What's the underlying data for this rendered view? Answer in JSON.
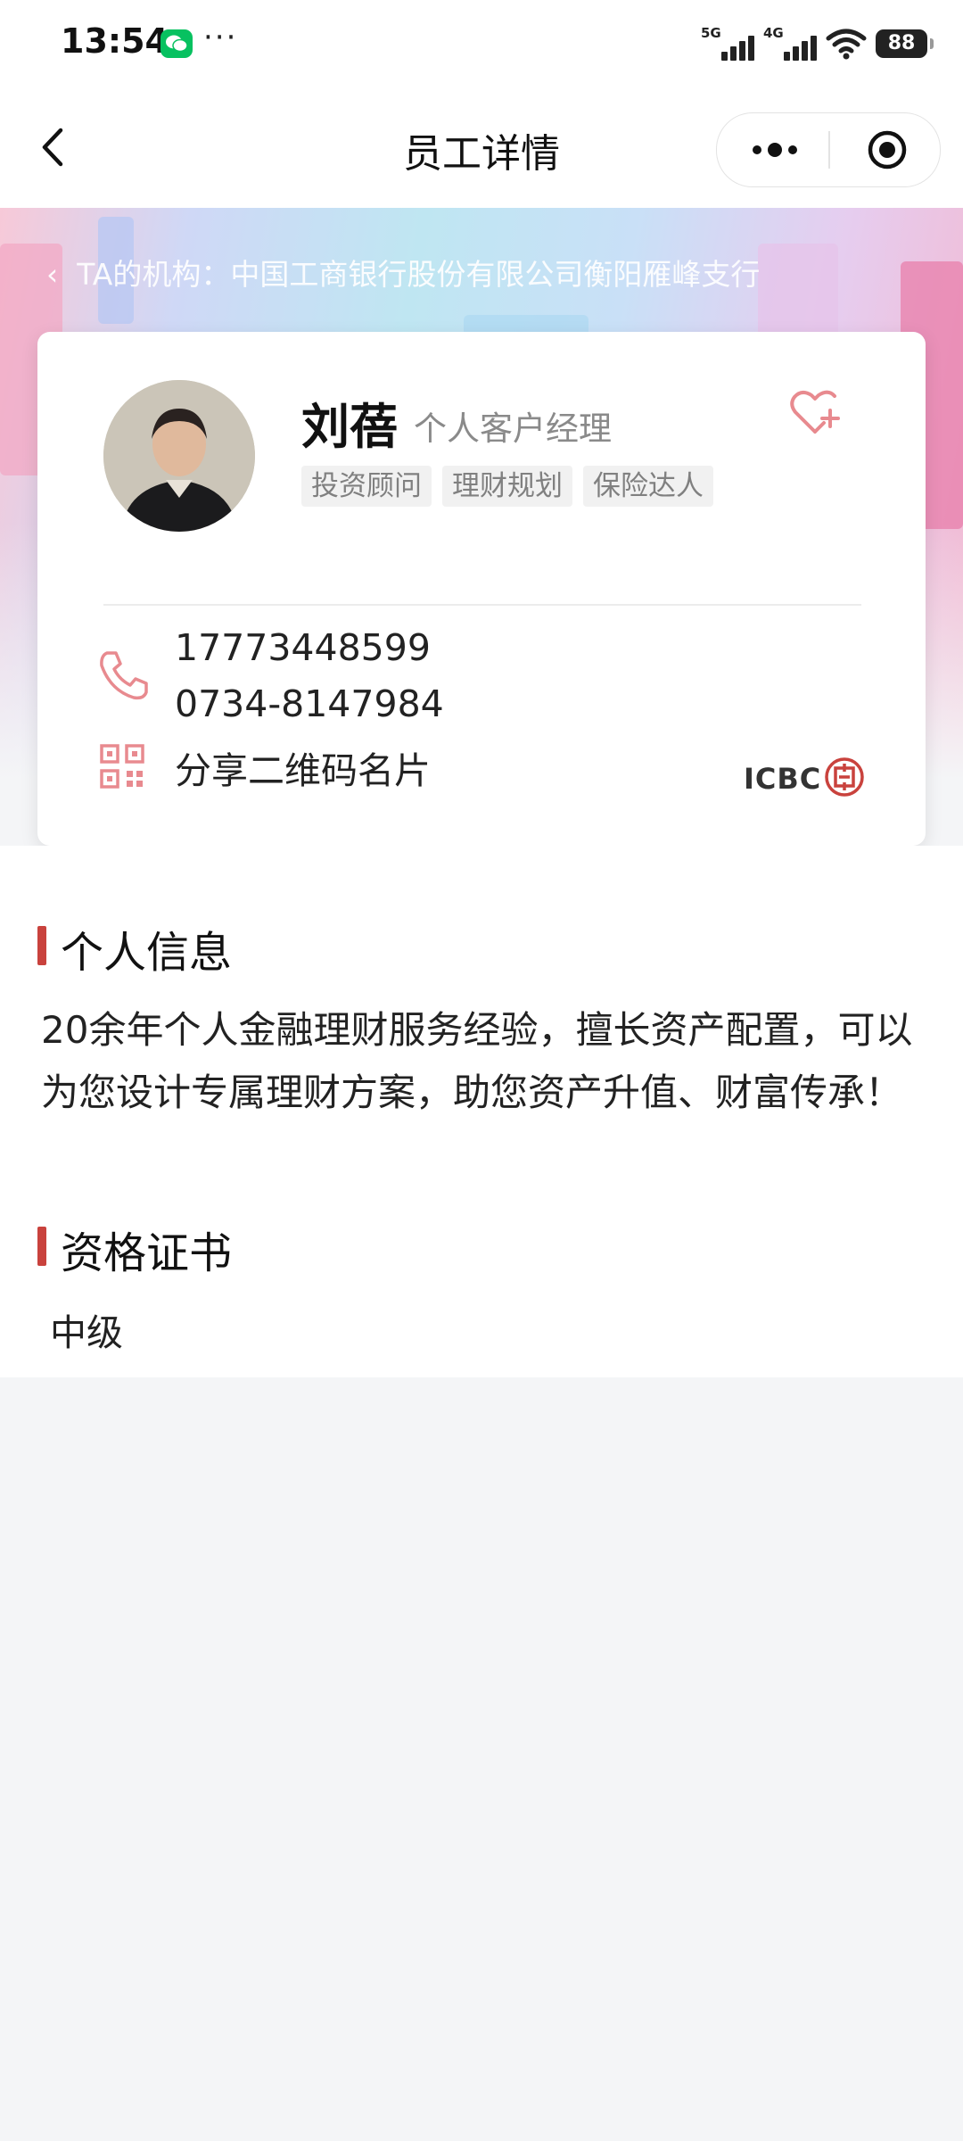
{
  "status_bar": {
    "time": "13:54",
    "more": "···",
    "network_1": "5G",
    "network_2": "4G",
    "battery": "88"
  },
  "nav": {
    "title": "员工详情"
  },
  "banner": {
    "org_label": "TA的机构：",
    "org_name": "中国工商银行股份有限公司衡阳雁峰支行"
  },
  "profile": {
    "name": "刘蓓",
    "role": "个人客户经理",
    "tags": [
      "投资顾问",
      "理财规划",
      "保险达人"
    ],
    "phone_mobile": "17773448599",
    "phone_office": "0734-8147984",
    "share_qr_label": "分享二维码名片",
    "bank_logo_text": "ICBC"
  },
  "personal_info": {
    "title": "个人信息",
    "text": "20余年个人金融理财服务经验，擅长资产配置，可以为您设计专属理财方案，助您资产升值、财富传承！"
  },
  "certificates": {
    "title": "资格证书",
    "value": "中级"
  },
  "colors": {
    "accent_red": "#c9423d",
    "icon_pink": "#e88a8f",
    "page_bg": "#f4f5f7"
  }
}
